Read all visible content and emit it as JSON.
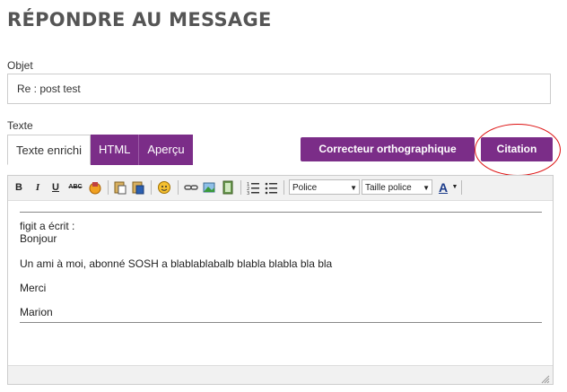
{
  "page": {
    "title": "RÉPONDRE AU MESSAGE"
  },
  "subject": {
    "label": "Objet",
    "value": "Re : post test"
  },
  "text": {
    "label": "Texte"
  },
  "tabs": [
    {
      "label": "Texte enrichi",
      "active": true
    },
    {
      "label": "HTML",
      "active": false
    },
    {
      "label": "Aperçu",
      "active": false
    }
  ],
  "buttons": {
    "spellcheck": "Correcteur orthographique",
    "quote": "Citation"
  },
  "toolbar": {
    "bold": "B",
    "italic": "I",
    "underline": "U",
    "strike": "ABC",
    "font_select": "Police",
    "size_select": "Taille police",
    "color": "A"
  },
  "content": {
    "quote_header": "figit a écrit :",
    "greeting": "Bonjour",
    "body": "Un ami à moi, abonné SOSH a blablablabalb blabla blabla bla bla",
    "thanks": "Merci",
    "signature": "Marion"
  },
  "colors": {
    "accent": "#7b2d88",
    "highlight_circle": "#dd1111"
  }
}
